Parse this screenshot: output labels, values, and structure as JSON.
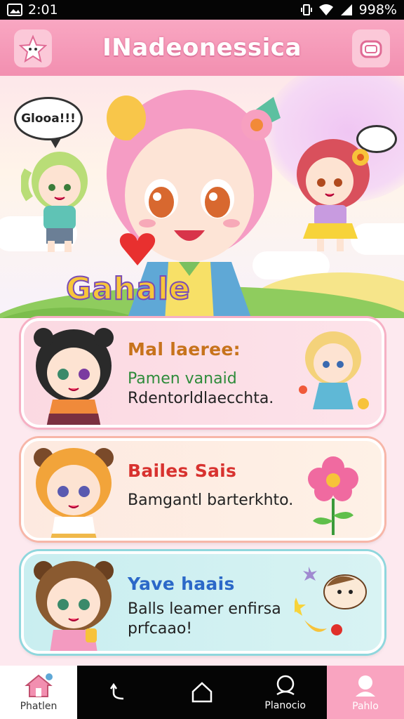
{
  "status": {
    "time": "2:01",
    "battery": "998%"
  },
  "header": {
    "title": "INadeonessica"
  },
  "hero": {
    "speech": "Glooa!!!",
    "logo": "Gahale"
  },
  "cards": [
    {
      "heading": "Mal laeree:",
      "line1": "Pamen vanaid",
      "line2": "Rdentorldlaecchta.",
      "heading_color": "#c7731c",
      "line1_color": "#2e8b3a"
    },
    {
      "heading": "Bailes Sais",
      "line1": "Bamgantl barterkhto.",
      "line2": "",
      "heading_color": "#d8322f",
      "line1_color": "#222222"
    },
    {
      "heading": "Yave haais",
      "line1": "Balls leamer enfirsa",
      "line2": "prfcaao!",
      "heading_color": "#2b68c8",
      "line1_color": "#222222"
    }
  ],
  "nav": {
    "home": "Phatlen",
    "back": "",
    "center": "",
    "search": "Planocio",
    "profile": "Pahlo"
  },
  "colors": {
    "accent": "#f28fb0",
    "nav_bg": "#050505"
  }
}
